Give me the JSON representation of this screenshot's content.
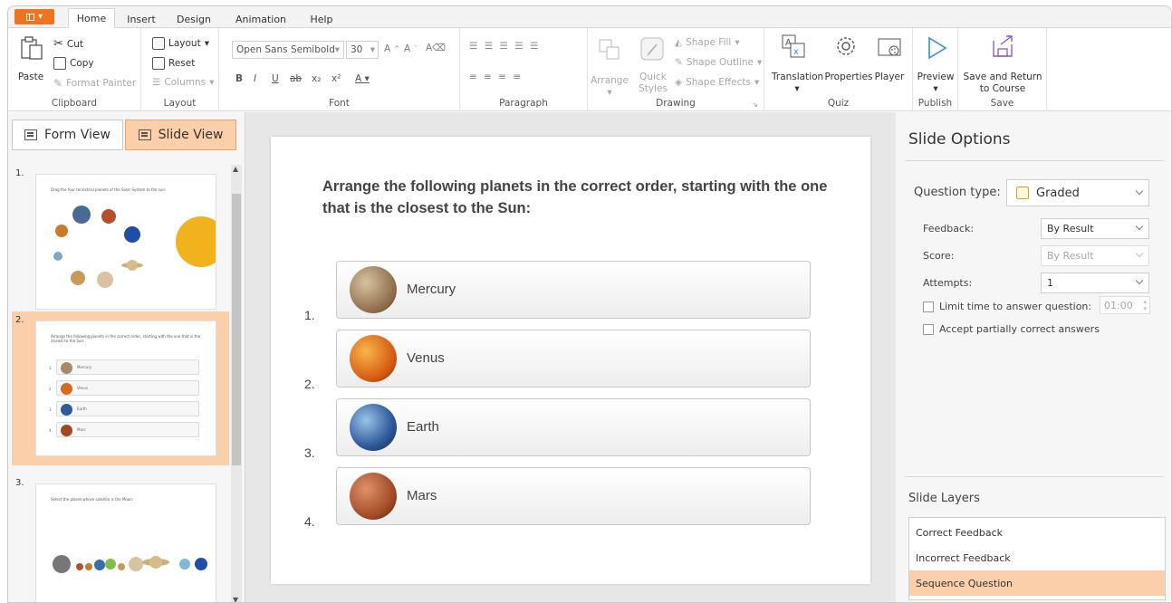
{
  "tabs": [
    "Home",
    "Insert",
    "Design",
    "Animation",
    "Help"
  ],
  "ribbon": {
    "clipboard": {
      "paste": "Paste",
      "cut": "Cut",
      "copy": "Copy",
      "format_painter": "Format Painter",
      "label": "Clipboard"
    },
    "layout": {
      "layout": "Layout",
      "reset": "Reset",
      "columns": "Columns",
      "label": "Layout"
    },
    "font": {
      "family": "Open Sans Semibold",
      "size": "30",
      "label": "Font"
    },
    "paragraph": {
      "label": "Paragraph"
    },
    "drawing": {
      "arrange": "Arrange",
      "quick_styles_line1": "Quick",
      "quick_styles_line2": "Styles",
      "shape_fill": "Shape Fill",
      "shape_outline": "Shape Outline",
      "shape_effects": "Shape Effects",
      "label": "Drawing"
    },
    "quiz": {
      "translation": "Translation",
      "properties": "Properties",
      "player": "Player",
      "label": "Quiz"
    },
    "publish": {
      "preview": "Preview",
      "label": "Publish"
    },
    "save": {
      "line1": "Save and Return",
      "line2": "to Course",
      "label": "Save"
    }
  },
  "view_buttons": {
    "form": "Form View",
    "slide": "Slide View"
  },
  "thumbnails": [
    {
      "num": "1.",
      "title": "Drag the four terrestrial planets of the Solar System to the sun:"
    },
    {
      "num": "2.",
      "title": "Arrange the following planets in the correct order, starting with the one that is the closest to the Sun:",
      "items": [
        "Mercury",
        "Venus",
        "Earth",
        "Mars"
      ]
    },
    {
      "num": "3.",
      "title": "Select the planet whose satellite is the Moon:"
    }
  ],
  "slide": {
    "question": "Arrange the following planets in the correct order, starting with the one that is the closest to the Sun:",
    "answers": [
      {
        "num": "1.",
        "label": "Mercury"
      },
      {
        "num": "2.",
        "label": "Venus"
      },
      {
        "num": "3.",
        "label": "Earth"
      },
      {
        "num": "4.",
        "label": "Mars"
      }
    ]
  },
  "slide_options": {
    "title": "Slide Options",
    "question_type_label": "Question type:",
    "question_type_value": "Graded",
    "feedback_label": "Feedback:",
    "feedback_value": "By Result",
    "score_label": "Score:",
    "score_value": "By Result",
    "attempts_label": "Attempts:",
    "attempts_value": "1",
    "limit_time_label": "Limit time to answer question:",
    "limit_time_value": "01:00",
    "accept_partial_label": "Accept partially correct answers"
  },
  "slide_layers": {
    "title": "Slide Layers",
    "items": [
      "Correct Feedback",
      "Incorrect Feedback",
      "Sequence Question"
    ],
    "selected_index": 2
  },
  "colors": {
    "accent": "#f0731f",
    "selection": "#fbcfa9",
    "preview_blue": "#2f8ef0"
  }
}
